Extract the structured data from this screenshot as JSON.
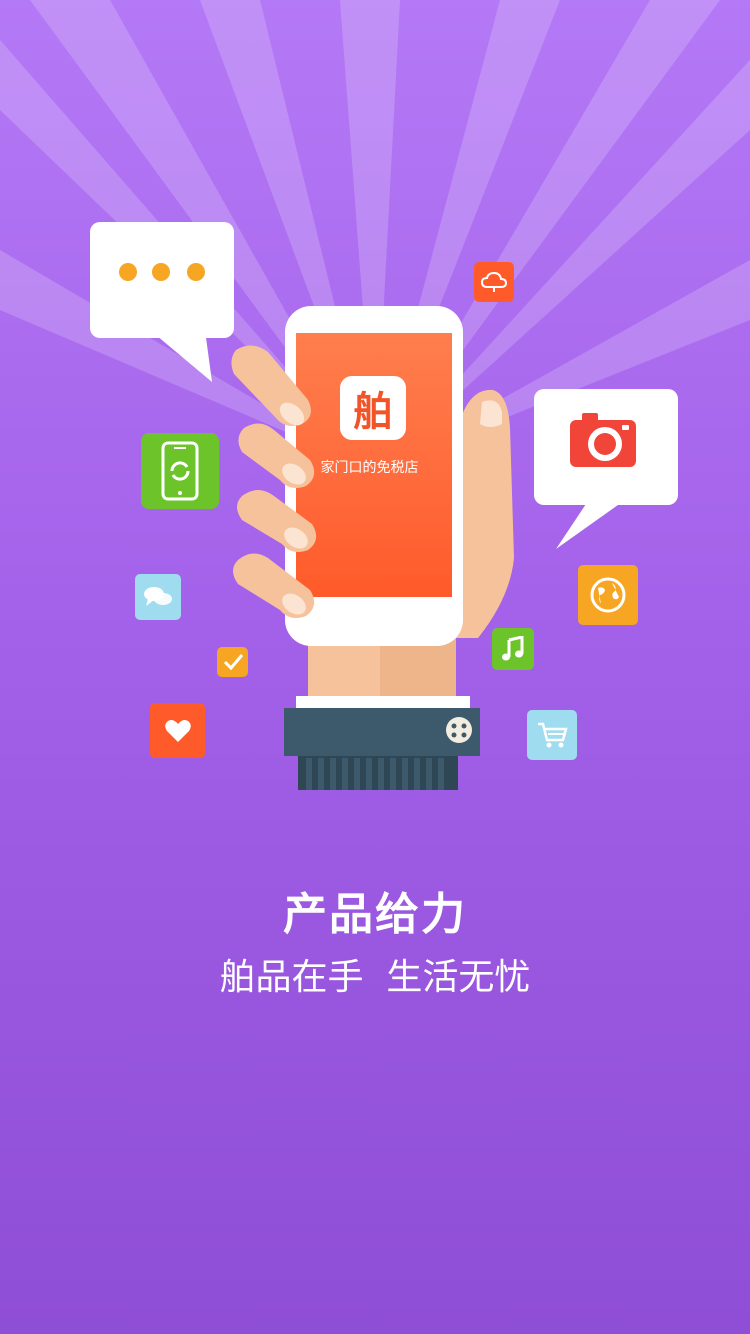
{
  "illustration": {
    "app_icon_glyph": "舶",
    "app_slogan": "家门口的免税店",
    "icons": [
      "chat-dots-icon",
      "cloud-icon",
      "camera-icon",
      "phone-rotate-icon",
      "speech-bubbles-icon",
      "checkbox-icon",
      "heart-icon",
      "globe-icon",
      "music-note-icon",
      "shopping-cart-icon"
    ],
    "colors": {
      "background_top": "#b479f6",
      "background_bottom": "#8f4ed6",
      "accent_orange": "#ff5a2a",
      "dot_yellow": "#f6a623",
      "green": "#6cc42a",
      "light_blue": "#9fdcef",
      "cuff": "#3c5a6b"
    }
  },
  "headline": {
    "title": "产品给力",
    "subtitle": "舶品在手  生活无忧"
  }
}
